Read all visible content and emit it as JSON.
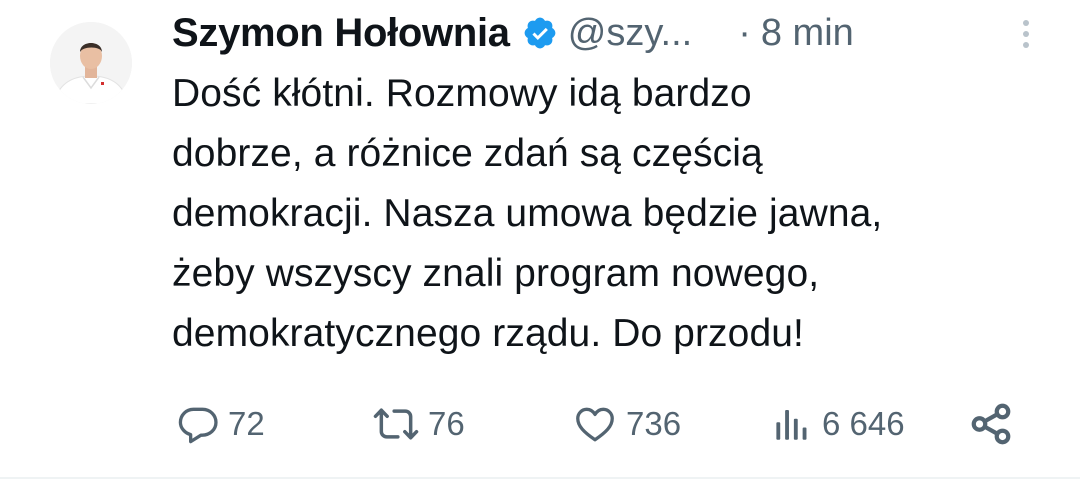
{
  "tweet": {
    "author_name": "Szymon Hołownia",
    "handle": "@szy...",
    "separator": "·",
    "time": "8 min",
    "verified_icon": "verified-badge-icon",
    "verified_color": "#1d9bf0",
    "text_lines": [
      "Dość kłótni. Rozmowy idą bardzo",
      "dobrze, a różnice zdań są częścią",
      "demokracji. Nasza umowa będzie jawna,",
      "żeby wszyscy znali program nowego,",
      "demokratycznego rządu. Do przodu!"
    ],
    "actions": {
      "reply_count": "72",
      "retweet_count": "76",
      "like_count": "736",
      "views_count": "6 646"
    },
    "icons": {
      "reply": "comment-icon",
      "retweet": "retweet-icon",
      "like": "heart-icon",
      "views": "views-chart-icon",
      "share": "share-icon",
      "more": "more-vertical-icon"
    }
  },
  "colors": {
    "text_primary": "#0f1419",
    "text_secondary": "#536471",
    "verified": "#1d9bf0"
  }
}
